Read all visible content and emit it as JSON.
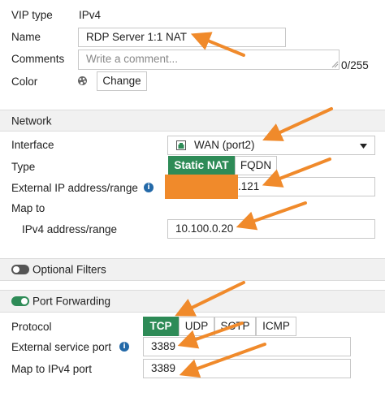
{
  "vip_type": {
    "label": "VIP type",
    "value": "IPv4"
  },
  "name": {
    "label": "Name",
    "value": "RDP Server 1:1 NAT"
  },
  "comments": {
    "label": "Comments",
    "placeholder": "Write a comment...",
    "counter": "0/255"
  },
  "color": {
    "label": "Color",
    "button": "Change"
  },
  "network": {
    "section_title": "Network",
    "interface": {
      "label": "Interface",
      "value": "WAN (port2)"
    },
    "type": {
      "label": "Type",
      "options": [
        "Static NAT",
        "FQDN"
      ],
      "selected": "Static NAT"
    },
    "external_ip": {
      "label": "External IP address/range",
      "value_suffix": ".121"
    },
    "map_to": {
      "label": "Map to",
      "ipv4_label": "IPv4 address/range",
      "ipv4_value": "10.100.0.20"
    }
  },
  "optional_filters": {
    "label": "Optional Filters",
    "enabled": false
  },
  "port_forwarding": {
    "label": "Port Forwarding",
    "enabled": true,
    "protocol": {
      "label": "Protocol",
      "options": [
        "TCP",
        "UDP",
        "SCTP",
        "ICMP"
      ],
      "selected": "TCP"
    },
    "external_port": {
      "label": "External service port",
      "value": "3389"
    },
    "map_port": {
      "label": "Map to IPv4 port",
      "value": "3389"
    }
  },
  "colors": {
    "accent_green": "#2e8b57",
    "annotation_orange": "#f08a2b",
    "info_blue": "#2369a8"
  }
}
